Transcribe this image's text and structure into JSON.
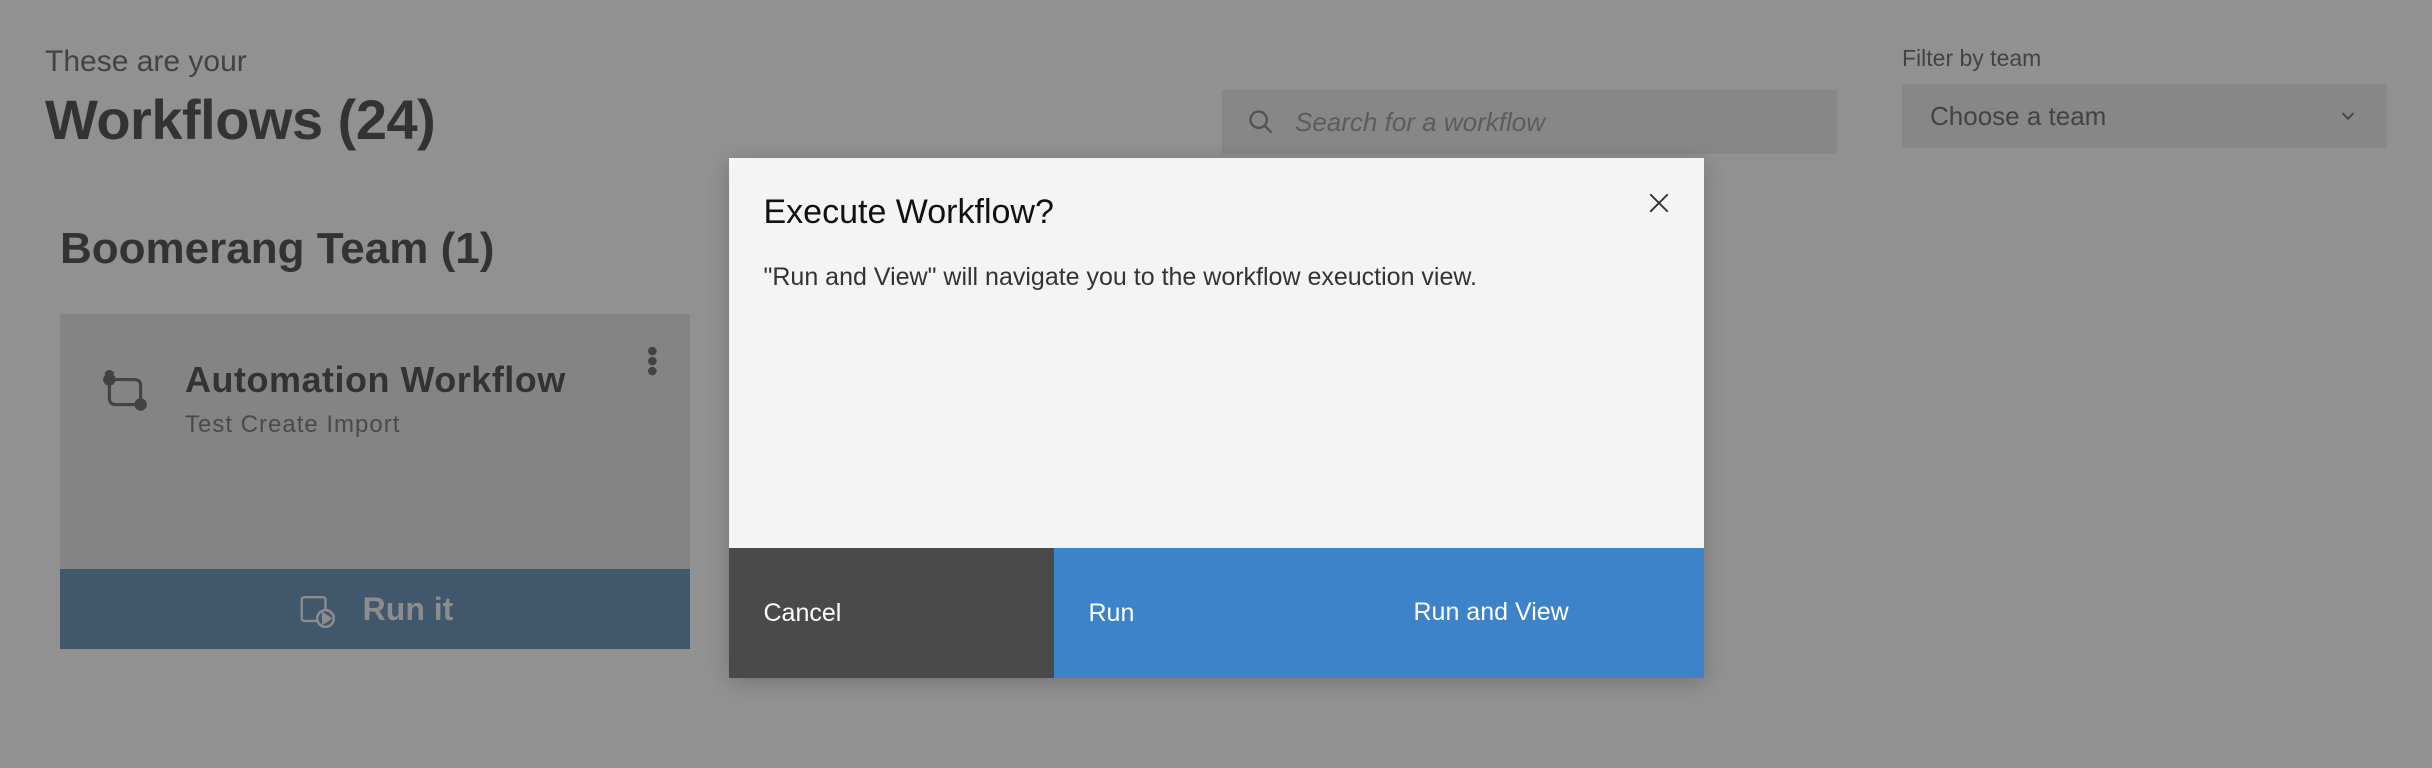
{
  "header": {
    "title_prefix": "These are your",
    "title_main": "Workflows (24)"
  },
  "search": {
    "placeholder": "Search for a workflow"
  },
  "filter": {
    "label": "Filter by team",
    "select_label": "Choose a team"
  },
  "team_section": {
    "heading": "Boomerang Team (1)"
  },
  "workflow_card": {
    "title": "Automation Workflow",
    "subtitle": "Test Create Import",
    "action_label": "Run it"
  },
  "modal": {
    "title": "Execute Workflow?",
    "description": "\"Run and View\" will navigate you to the workflow exeuction view.",
    "cancel_label": "Cancel",
    "run_label": "Run",
    "runview_label": "Run and View"
  }
}
